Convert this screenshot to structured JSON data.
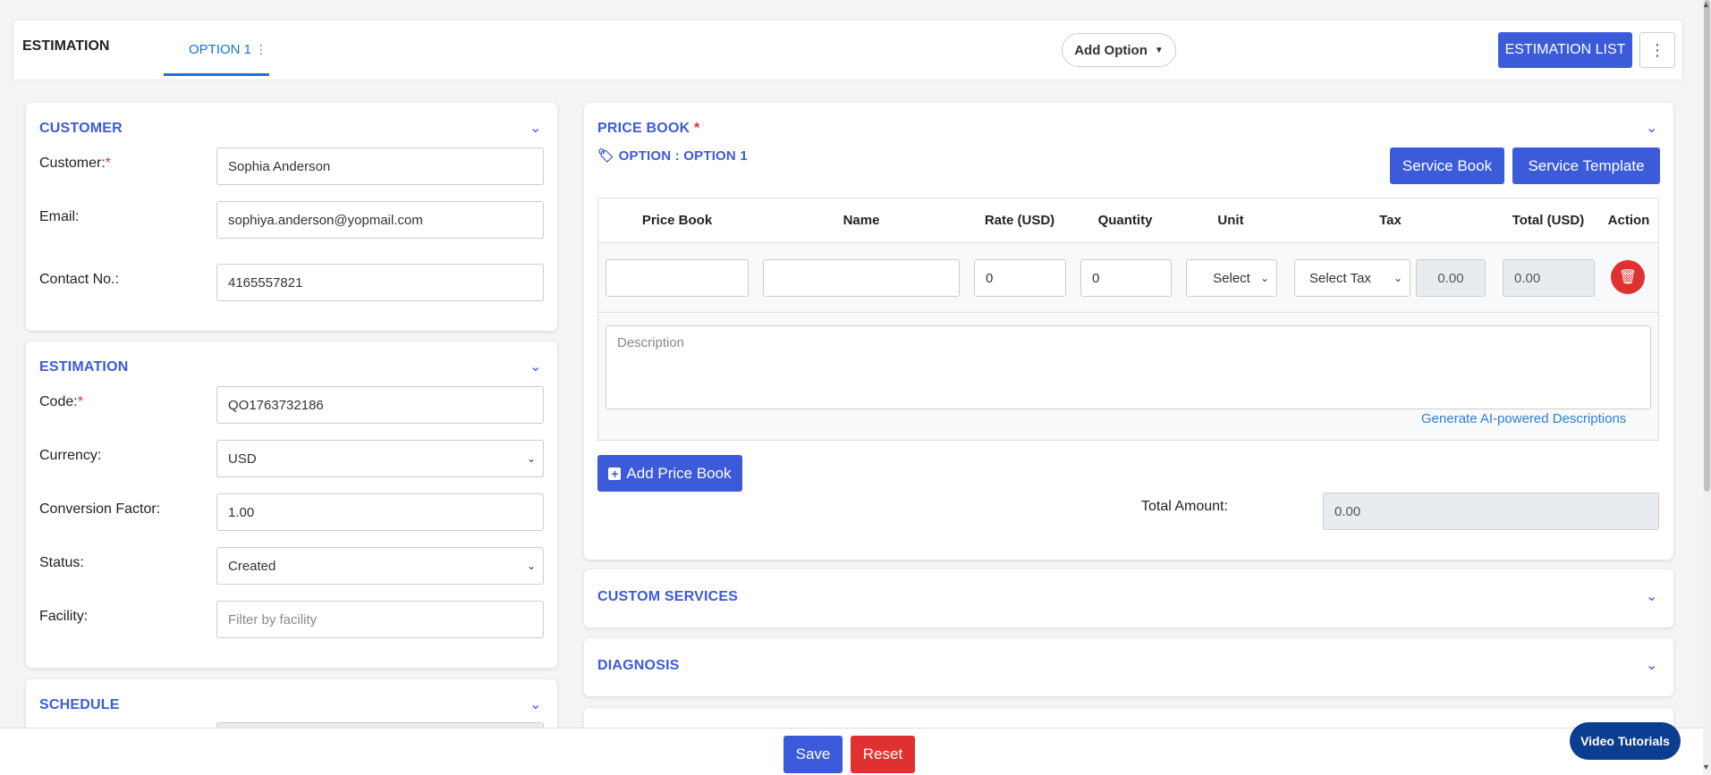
{
  "header": {
    "title": "ESTIMATION",
    "tab_label": "OPTION 1",
    "add_option_label": "Add Option",
    "estimation_list_label": "ESTIMATION LIST"
  },
  "customer": {
    "section_title": "CUSTOMER",
    "customer_label": "Customer:",
    "customer_value": "Sophia Anderson",
    "email_label": "Email:",
    "email_value": "sophiya.anderson@yopmail.com",
    "contact_label": "Contact No.:",
    "contact_value": "4165557821"
  },
  "estimation": {
    "section_title": "ESTIMATION",
    "code_label": "Code:",
    "code_value": "QO1763732186",
    "currency_label": "Currency:",
    "currency_value": "USD",
    "conversion_label": "Conversion Factor:",
    "conversion_value": "1.00",
    "status_label": "Status:",
    "status_value": "Created",
    "facility_label": "Facility:",
    "facility_placeholder": "Filter by facility"
  },
  "schedule": {
    "section_title": "SCHEDULE"
  },
  "price_book": {
    "section_title": "PRICE BOOK",
    "option_label": "OPTION : OPTION 1",
    "service_book_label": "Service Book",
    "service_template_label": "Service Template",
    "columns": [
      "Price Book",
      "Name",
      "Rate (USD)",
      "Quantity",
      "Unit",
      "Tax",
      "Total (USD)",
      "Action"
    ],
    "row": {
      "price_book": "",
      "name": "",
      "rate": "0",
      "quantity": "0",
      "unit": "Select",
      "tax": "Select Tax",
      "tax_amount": "0.00",
      "total": "0.00"
    },
    "description_placeholder": "Description",
    "ai_link": "Generate AI-powered Descriptions",
    "add_price_book_label": "Add Price Book",
    "total_amount_label": "Total Amount:",
    "total_amount_value": "0.00"
  },
  "custom_services": {
    "section_title": "CUSTOM SERVICES"
  },
  "diagnosis": {
    "section_title": "DIAGNOSIS"
  },
  "footer": {
    "save_label": "Save",
    "reset_label": "Reset",
    "video_label": "Video Tutorials"
  },
  "icons": {
    "chevron": "chevron-down-icon",
    "tag": "tag-icon",
    "trash": "trash-icon",
    "plus": "plus-square-icon",
    "kebab": "kebab-icon"
  },
  "colors": {
    "accent": "#3b5bdb",
    "tab_blue": "#1a73d9",
    "danger": "#e03131",
    "navy": "#0b3d91"
  }
}
